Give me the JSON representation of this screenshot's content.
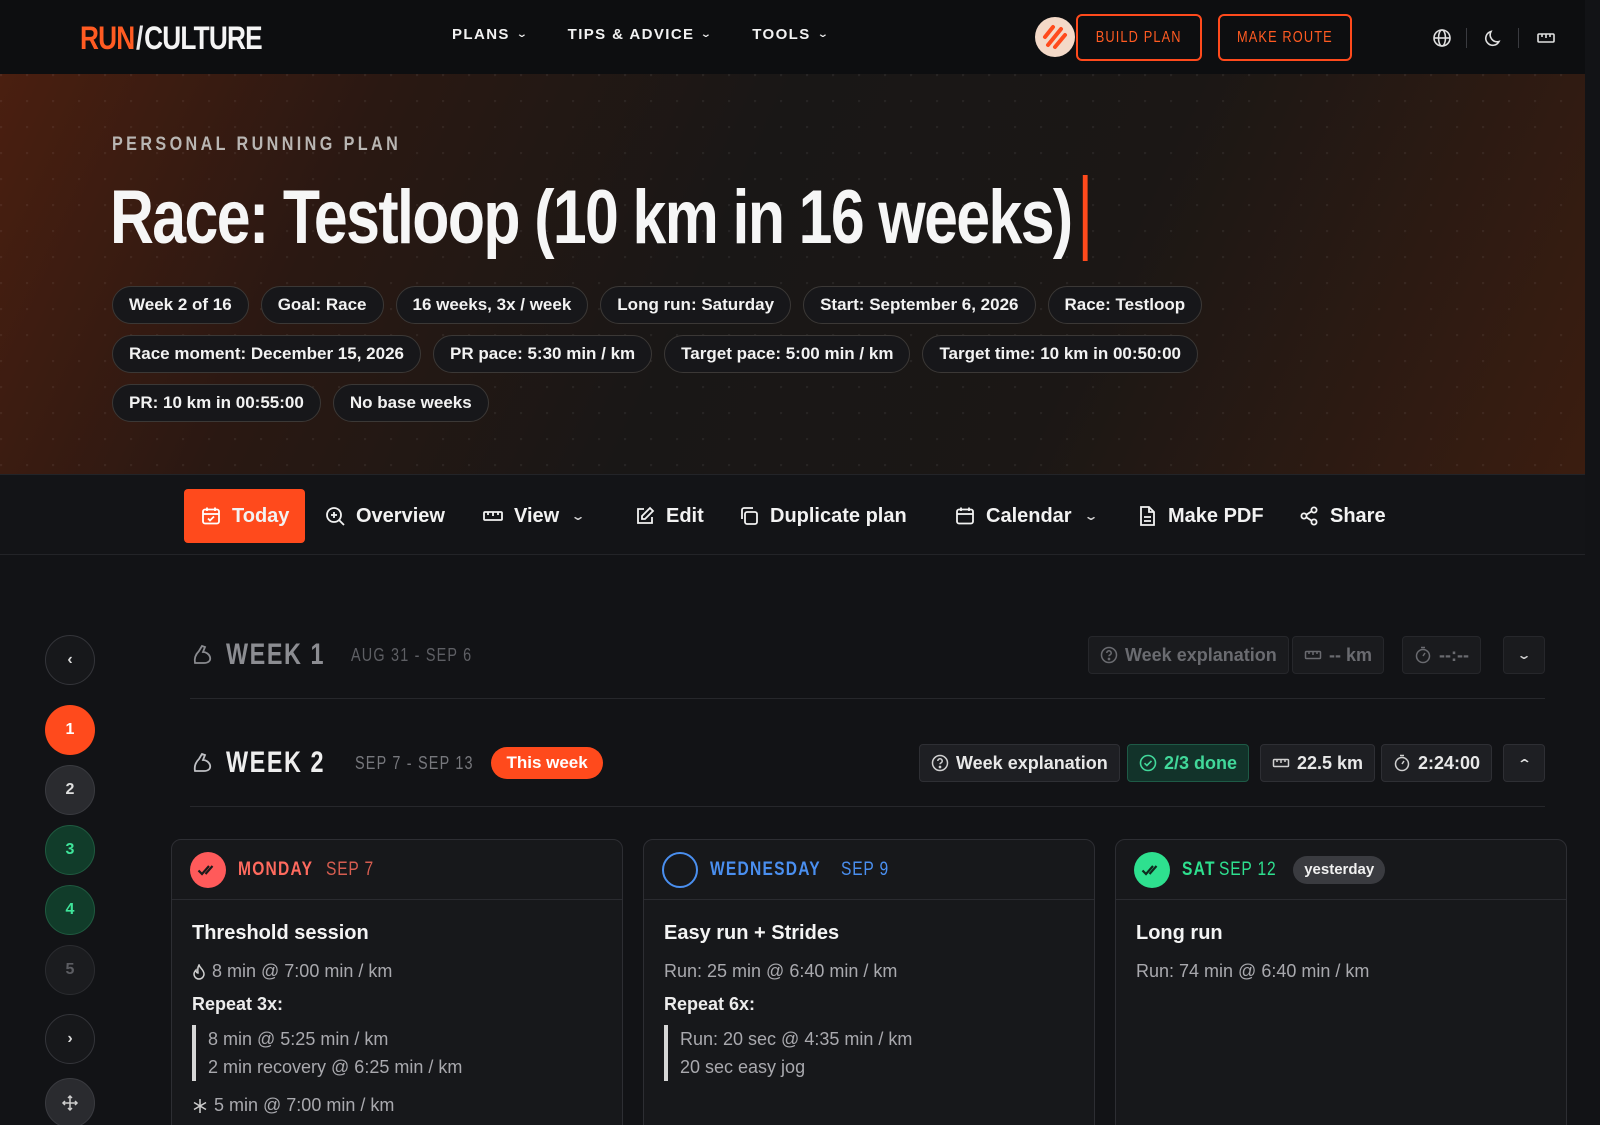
{
  "nav": {
    "logo_run": "RUN",
    "logo_slash": "/",
    "logo_culture": "CULTURE",
    "links": [
      {
        "label": "PLANS"
      },
      {
        "label": "TIPS & ADVICE"
      },
      {
        "label": "TOOLS"
      }
    ],
    "build_plan": "BUILD PLAN",
    "make_route": "MAKE ROUTE"
  },
  "hero": {
    "eyebrow": "PERSONAL RUNNING PLAN",
    "title": "Race: Testloop (10 km in 16 weeks)",
    "chips": [
      "Week 2 of 16",
      "Goal: Race",
      "16 weeks, 3x / week",
      "Long run: Saturday",
      "Start: September 6, 2026",
      "Race: Testloop",
      "Race moment: December 15, 2026",
      "PR pace: 5:30 min / km",
      "Target pace: 5:00 min / km",
      "Target time: 10 km in 00:50:00",
      "PR: 10 km in 00:55:00",
      "No base weeks"
    ]
  },
  "toolbar": {
    "today": "Today",
    "overview": "Overview",
    "view": "View",
    "edit": "Edit",
    "duplicate": "Duplicate plan",
    "calendar": "Calendar",
    "pdf": "Make PDF",
    "share": "Share"
  },
  "rail": {
    "weeks": [
      "1",
      "2",
      "3",
      "4",
      "5"
    ]
  },
  "weeks": [
    {
      "label": "WEEK 1",
      "range": "AUG 31 - SEP 6",
      "explanation": "Week explanation",
      "distance": "-- km",
      "time": "--:--"
    },
    {
      "label": "WEEK 2",
      "range": "SEP 7 - SEP 13",
      "badge": "This week",
      "explanation": "Week explanation",
      "done": "2/3 done",
      "distance": "22.5 km",
      "time": "2:24:00"
    }
  ],
  "days": [
    {
      "name": "MONDAY",
      "date": "SEP 7",
      "title": "Threshold session",
      "warmup": "8 min @ 7:00 min / km",
      "repeat_label": "Repeat 3x:",
      "repeat_lines": [
        "8 min @ 5:25 min / km",
        "2 min recovery @ 6:25 min / km"
      ],
      "cooldown": "5 min @ 7:00 min / km",
      "color": "#ff5a5a"
    },
    {
      "name": "WEDNESDAY",
      "date": "SEP 9",
      "title": "Easy run + Strides",
      "line": "Run: 25 min @ 6:40 min / km",
      "repeat_label": "Repeat 6x:",
      "repeat_lines": [
        "Run: 20 sec @ 4:35 min / km",
        "20 sec easy jog"
      ],
      "color": "#4a8ff0"
    },
    {
      "name": "SAT",
      "date": "SEP 12",
      "tag": "yesterday",
      "title": "Long run",
      "line": "Run: 74 min @ 6:40 min / km",
      "color": "#2ee08f"
    }
  ],
  "colors": {
    "accent": "#ff4a1c",
    "done_green": "#41d89a",
    "background": "#121316"
  }
}
